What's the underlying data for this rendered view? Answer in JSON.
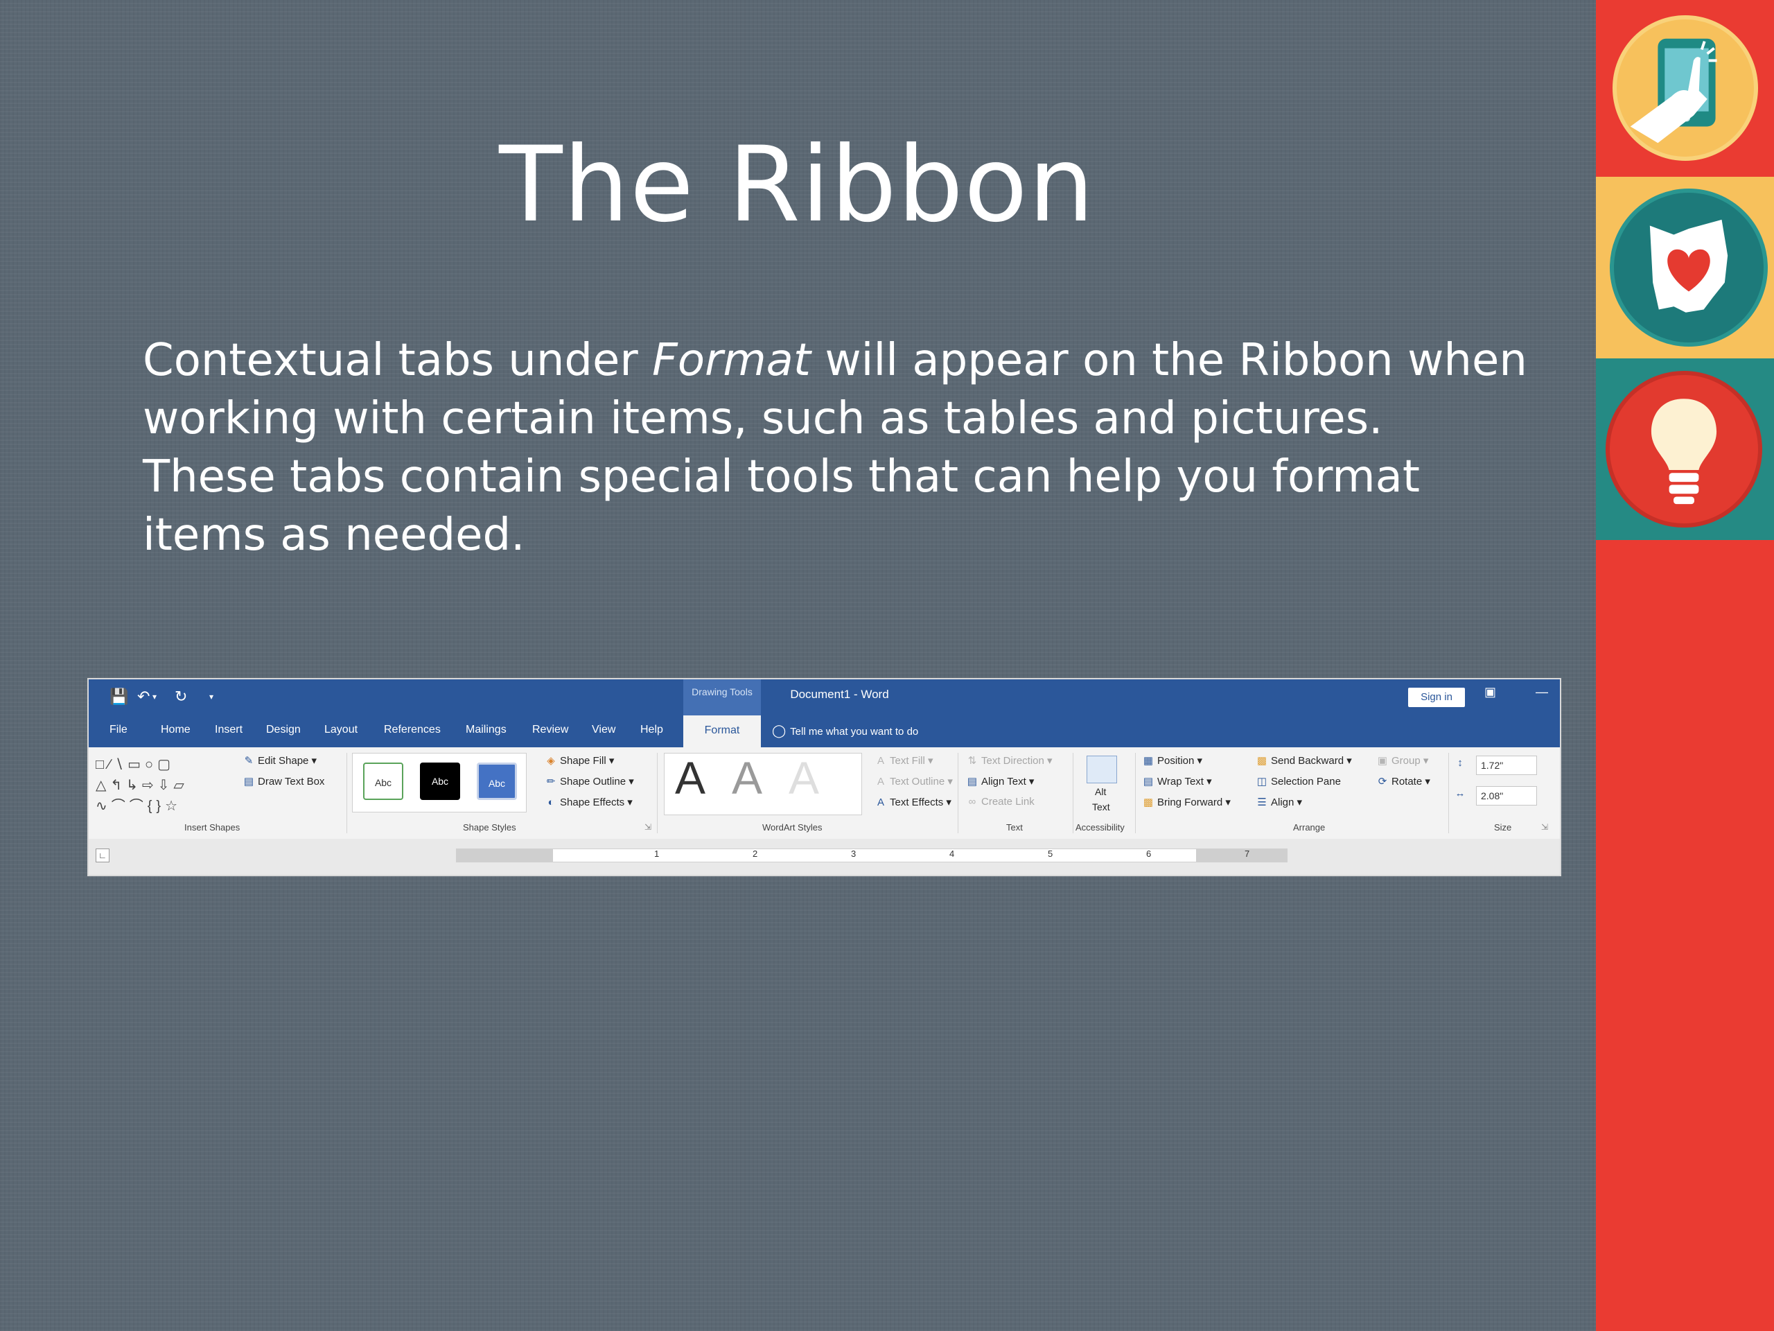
{
  "slide": {
    "title": "The Ribbon",
    "body_part1": "Contextual tabs under ",
    "body_emph": "Format",
    "body_part2": " will appear on the Ribbon when working with certain items, such as tables and pictures.  These tabs contain special tools that can help you format items as needed."
  },
  "colors": {
    "background": "#5b6873",
    "band_red": "#ea3b32",
    "band_yellow": "#f7c15c",
    "band_teal": "#258a84",
    "word_blue": "#2b579a"
  },
  "side_icons": [
    "tablet-touch-icon",
    "ohio-heart-icon",
    "lightbulb-icon"
  ],
  "word": {
    "contextual_group": "Drawing Tools",
    "doc_title": "Document1  -  Word",
    "sign_in": "Sign in",
    "tabs": [
      "File",
      "Home",
      "Insert",
      "Design",
      "Layout",
      "References",
      "Mailings",
      "Review",
      "View",
      "Help"
    ],
    "active_tab": "Format",
    "tell_me": "Tell me what you want to do",
    "groups": {
      "insert_shapes": {
        "label": "Insert Shapes",
        "edit_shape": "Edit Shape",
        "draw_text_box": "Draw Text Box"
      },
      "shape_styles": {
        "label": "Shape Styles",
        "swatch": "Abc",
        "shape_fill": "Shape Fill",
        "shape_outline": "Shape Outline",
        "shape_effects": "Shape Effects"
      },
      "wordart_styles": {
        "label": "WordArt Styles",
        "letter": "A",
        "text_fill": "Text Fill",
        "text_outline": "Text Outline",
        "text_effects": "Text Effects"
      },
      "text": {
        "label": "Text",
        "text_direction": "Text Direction",
        "align_text": "Align Text",
        "create_link": "Create Link"
      },
      "accessibility": {
        "label": "Accessibility",
        "alt_text_1": "Alt",
        "alt_text_2": "Text"
      },
      "arrange": {
        "label": "Arrange",
        "position": "Position",
        "wrap_text": "Wrap Text",
        "bring_forward": "Bring Forward",
        "send_backward": "Send Backward",
        "selection_pane": "Selection Pane",
        "align": "Align",
        "group": "Group",
        "rotate": "Rotate"
      },
      "size": {
        "label": "Size",
        "height": "1.72\"",
        "width": "2.08\""
      }
    },
    "ruler_numbers": [
      "1",
      "2",
      "3",
      "4",
      "5",
      "6",
      "7"
    ]
  }
}
